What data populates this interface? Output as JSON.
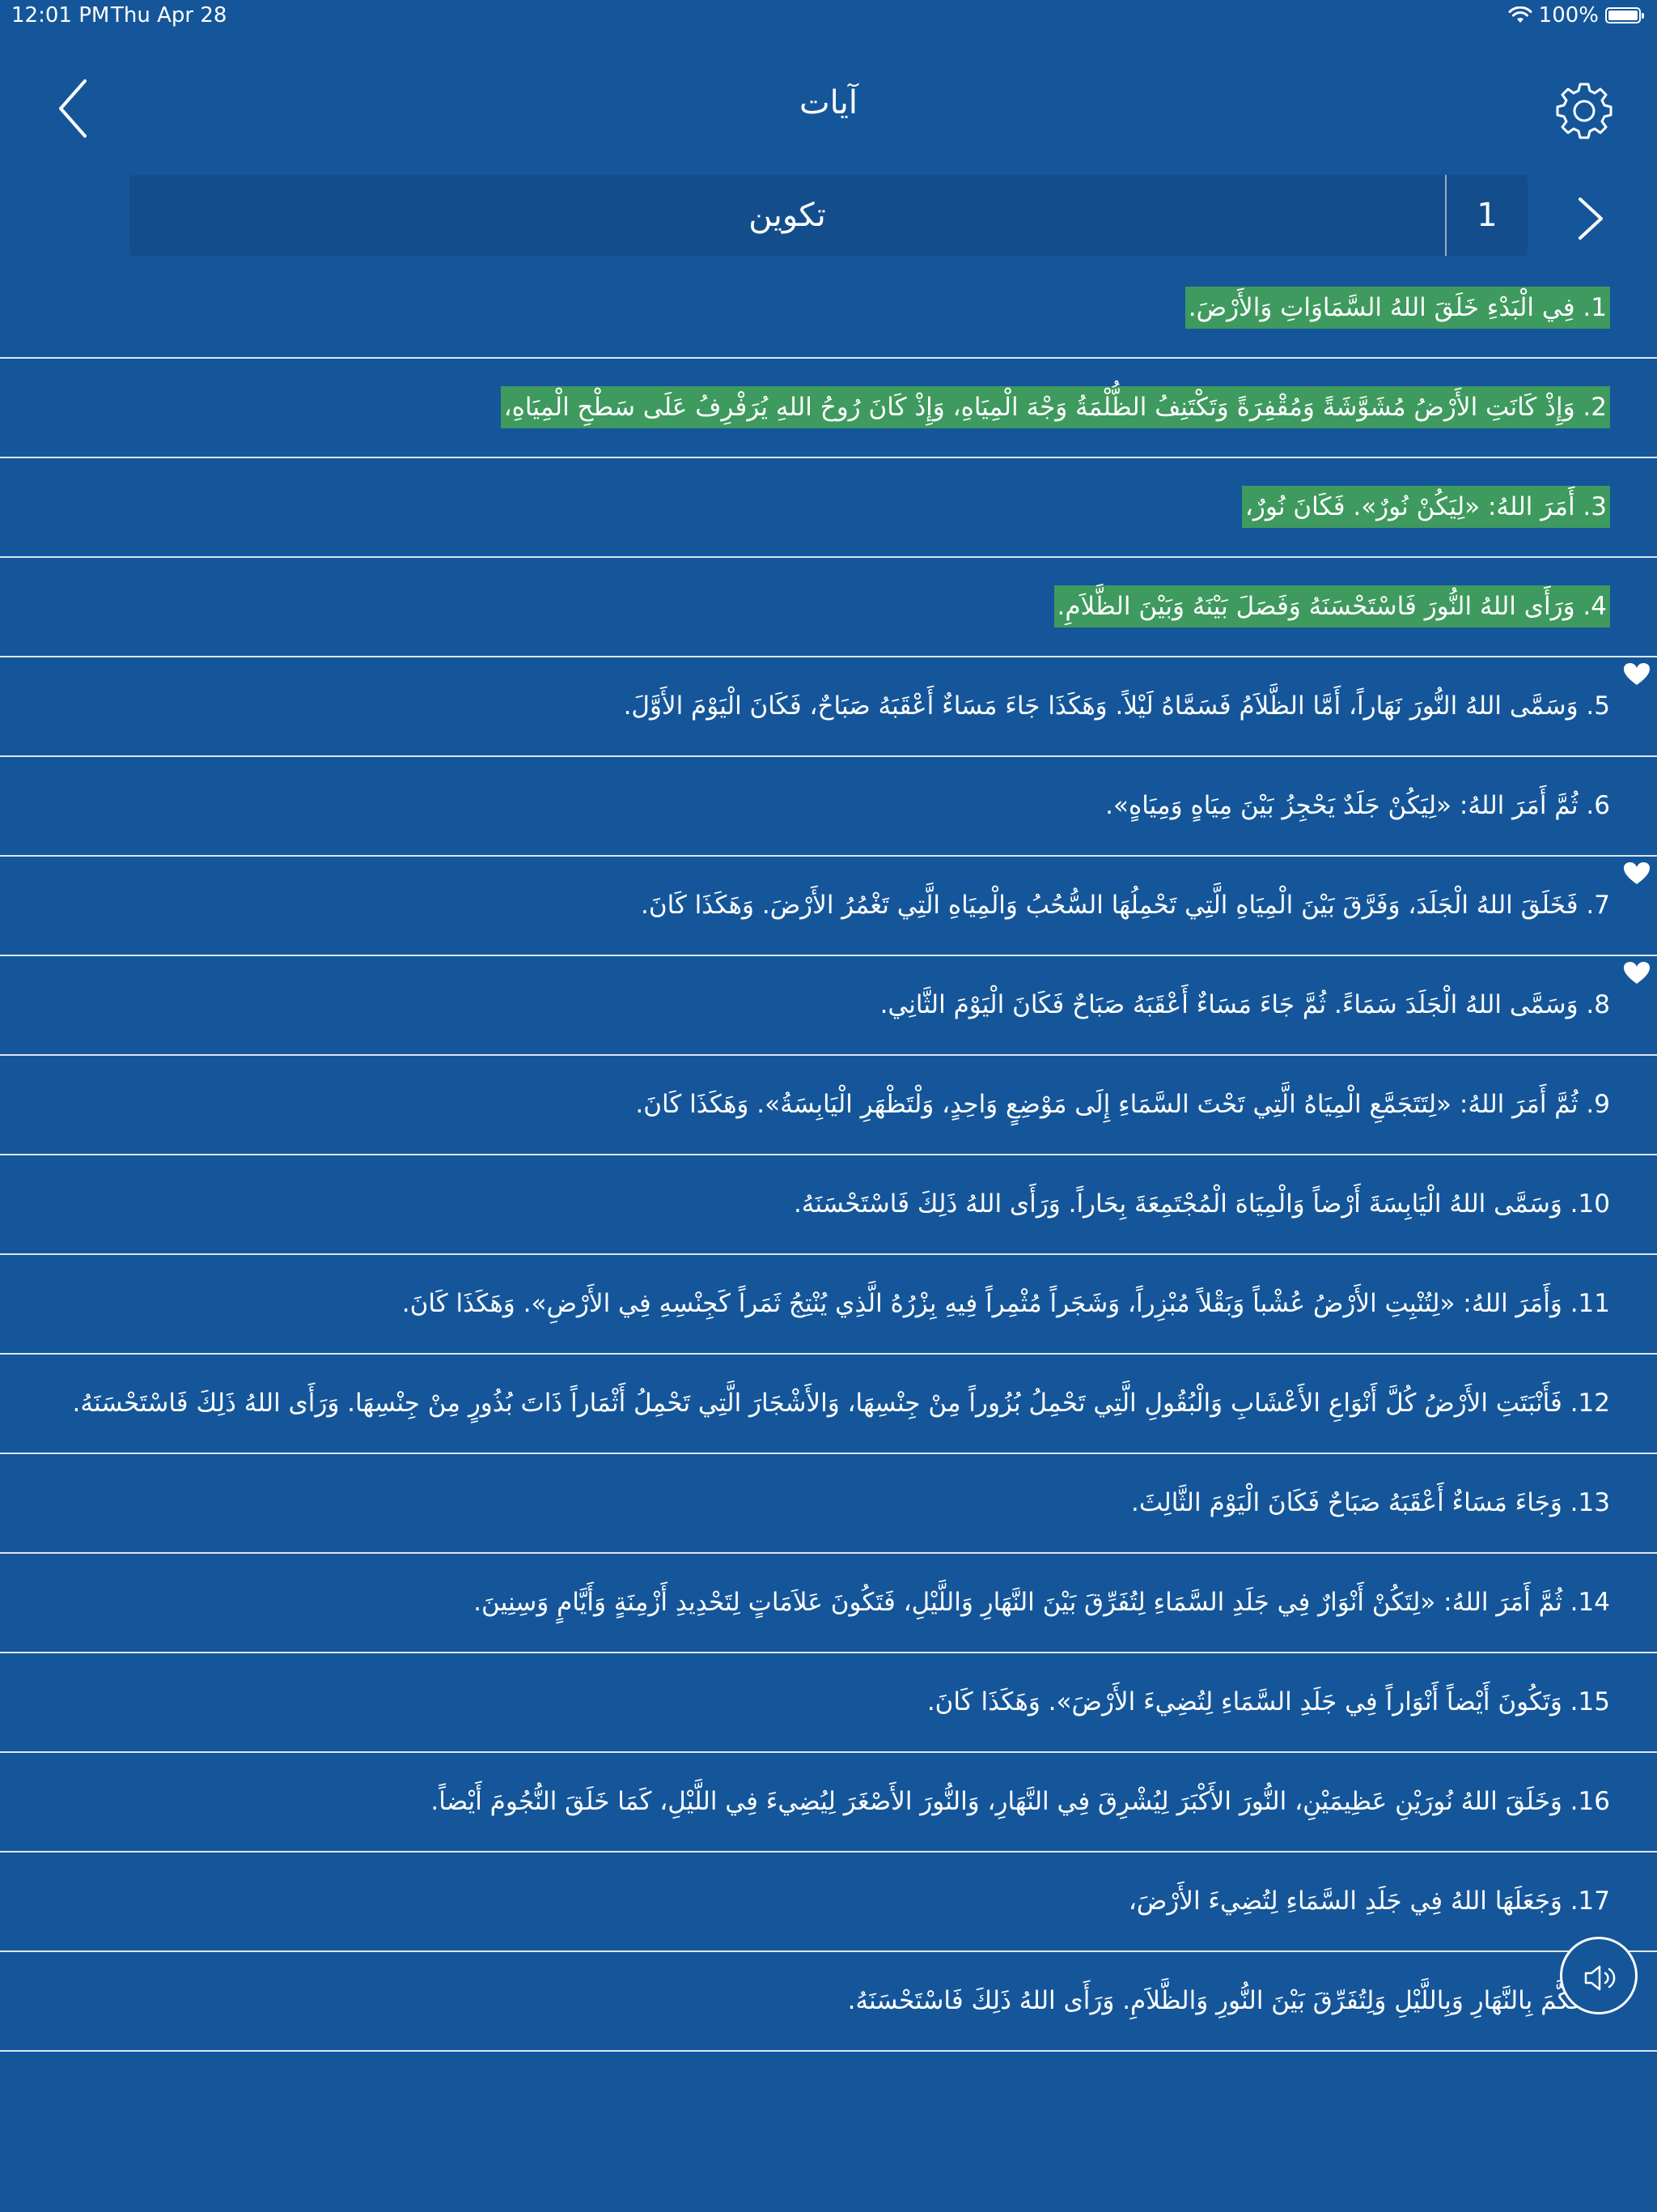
{
  "status": {
    "time": "12:01 PM",
    "date": "Thu Apr 28",
    "battery": "100%"
  },
  "header": {
    "title": "آيات"
  },
  "chapter": {
    "book": "تكوين",
    "number": "1"
  },
  "verses": [
    {
      "n": "1",
      "text": "فِي الْبَدْءِ خَلَقَ اللهُ السَّمَاوَاتِ وَالأَرْضَ.",
      "highlighted": true,
      "favorite": false
    },
    {
      "n": "2",
      "text": "وَإِذْ كَانَتِ الأَرْضُ مُشَوَّشَةً وَمُقْفِرَةً وَتَكْتَنِفُ الظُّلْمَةُ وَجْهَ الْمِيَاهِ، وَإِذْ كَانَ رُوحُ اللهِ يُرَفْرِفُ عَلَى سَطْحِ الْمِيَاهِ،",
      "highlighted": true,
      "favorite": false
    },
    {
      "n": "3",
      "text": "أَمَرَ اللهُ: «لِيَكُنْ نُورٌ». فَكَانَ نُورٌ،",
      "highlighted": true,
      "favorite": false
    },
    {
      "n": "4",
      "text": "وَرَأَى اللهُ النُّورَ فَاسْتَحْسَنَهُ وَفَصَلَ بَيْنَهُ وَبَيْنَ الظَّلاَمِ.",
      "highlighted": true,
      "favorite": false
    },
    {
      "n": "5",
      "text": "وَسَمَّى اللهُ النُّورَ نَهَاراً، أَمَّا الظَّلاَمُ فَسَمَّاهُ لَيْلاً. وَهَكَذَا جَاءَ مَسَاءٌ أَعْقَبَهُ صَبَاحٌ، فَكَانَ الْيَوْمَ الأَوَّلَ.",
      "highlighted": false,
      "favorite": true
    },
    {
      "n": "6",
      "text": "ثُمَّ أَمَرَ اللهُ: «لِيَكُنْ جَلَدٌ يَحْجِزُ بَيْنَ مِيَاهٍ وَمِيَاهٍ».",
      "highlighted": false,
      "favorite": false
    },
    {
      "n": "7",
      "text": "فَخَلَقَ اللهُ الْجَلَدَ، وَفَرَّقَ بَيْنَ الْمِيَاهِ الَّتِي تَحْمِلُهَا السُّحُبُ وَالْمِيَاهِ الَّتِي تَغْمُرُ الأَرْضَ. وَهَكَذَا كَانَ.",
      "highlighted": false,
      "favorite": true
    },
    {
      "n": "8",
      "text": "وَسَمَّى اللهُ الْجَلَدَ سَمَاءً. ثُمَّ جَاءَ مَسَاءٌ أَعْقَبَهُ صَبَاحٌ فَكَانَ الْيَوْمَ الثَّانِي.",
      "highlighted": false,
      "favorite": true
    },
    {
      "n": "9",
      "text": "ثُمَّ أَمَرَ اللهُ: «لِتَتَجَمَّعِ الْمِيَاهُ الَّتِي تَحْتَ السَّمَاءِ إِلَى مَوْضِعٍ وَاحِدٍ، وَلْتَظْهَرِ الْيَابِسَةُ». وَهَكَذَا كَانَ.",
      "highlighted": false,
      "favorite": false
    },
    {
      "n": "10",
      "text": "وَسَمَّى اللهُ الْيَابِسَةَ أَرْضاً وَالْمِيَاهَ الْمُجْتَمِعَةَ بِحَاراً. وَرَأَى اللهُ ذَلِكَ فَاسْتَحْسَنَهُ.",
      "highlighted": false,
      "favorite": false
    },
    {
      "n": "11",
      "text": "وَأَمَرَ اللهُ: «لِتُنْبِتِ الأَرْضُ عُشْباً وَبَقْلاً مُبْزِراً، وَشَجَراً مُثْمِراً فِيهِ بِزْرُهُ الَّذِي يُنْتِجُ ثَمَراً كَجِنْسِهِ فِي الأَرْضِ». وَهَكَذَا كَانَ.",
      "highlighted": false,
      "favorite": false
    },
    {
      "n": "12",
      "text": "فَأَنْبَتَتِ الأَرْضُ كُلَّ أَنْوَاعِ الأَعْشَابِ وَالْبُقُولِ الَّتِي تَحْمِلُ بُزُوراً مِنْ جِنْسِهَا، وَالأَشْجَارَ الَّتِي تَحْمِلُ أَثْمَاراً ذَاتَ بُذُورٍ مِنْ جِنْسِهَا. وَرَأَى اللهُ ذَلِكَ فَاسْتَحْسَنَهُ.",
      "highlighted": false,
      "favorite": false
    },
    {
      "n": "13",
      "text": "وَجَاءَ مَسَاءٌ أَعْقَبَهُ صَبَاحٌ فَكَانَ الْيَوْمَ الثَّالِثَ.",
      "highlighted": false,
      "favorite": false
    },
    {
      "n": "14",
      "text": "ثُمَّ أَمَرَ اللهُ: «لِتَكُنْ أَنْوَارٌ فِي جَلَدِ السَّمَاءِ لِتُفَرِّقَ بَيْنَ النَّهَارِ وَاللَّيْلِ، فَتَكُونَ عَلاَمَاتٍ لِتَحْدِيدِ أَزْمِنَةٍ وَأَيَّامٍ وَسِنِينَ.",
      "highlighted": false,
      "favorite": false
    },
    {
      "n": "15",
      "text": "وَتَكُونَ أَيْضاً أَنْوَاراً فِي جَلَدِ السَّمَاءِ لِتُضِيءَ الأَرْضَ». وَهَكَذَا كَانَ.",
      "highlighted": false,
      "favorite": false
    },
    {
      "n": "16",
      "text": "وَخَلَقَ اللهُ نُورَيْنِ عَظِيمَيْنِ، النُّورَ الأَكْبَرَ لِيُشْرِقَ فِي النَّهَارِ، وَالنُّورَ الأَصْغَرَ لِيُضِيءَ فِي اللَّيْلِ، كَمَا خَلَقَ النُّجُومَ أَيْضاً.",
      "highlighted": false,
      "favorite": false
    },
    {
      "n": "17",
      "text": "وَجَعَلَهَا اللهُ فِي جَلَدِ السَّمَاءِ لِتُضِيءَ الأَرْضَ،",
      "highlighted": false,
      "favorite": false
    },
    {
      "n": "",
      "text": "لِتَتَحَكَّمَ بِالنَّهَارِ وَبِاللَّيْلِ وَلِتُفَرِّقَ بَيْنَ النُّورِ وَالظَّلاَمِ. وَرَأَى اللهُ ذَلِكَ فَاسْتَحْسَنَهُ.",
      "highlighted": false,
      "favorite": false
    }
  ],
  "colors": {
    "background": "#15569A",
    "bar": "#134D8C",
    "highlight": "#3E9A5E",
    "text": "#FFFFFF"
  },
  "icons": {
    "back": "chevron-left-icon",
    "settings": "gear-icon",
    "next": "chevron-right-icon",
    "favorite": "heart-icon",
    "audio": "speaker-icon"
  }
}
